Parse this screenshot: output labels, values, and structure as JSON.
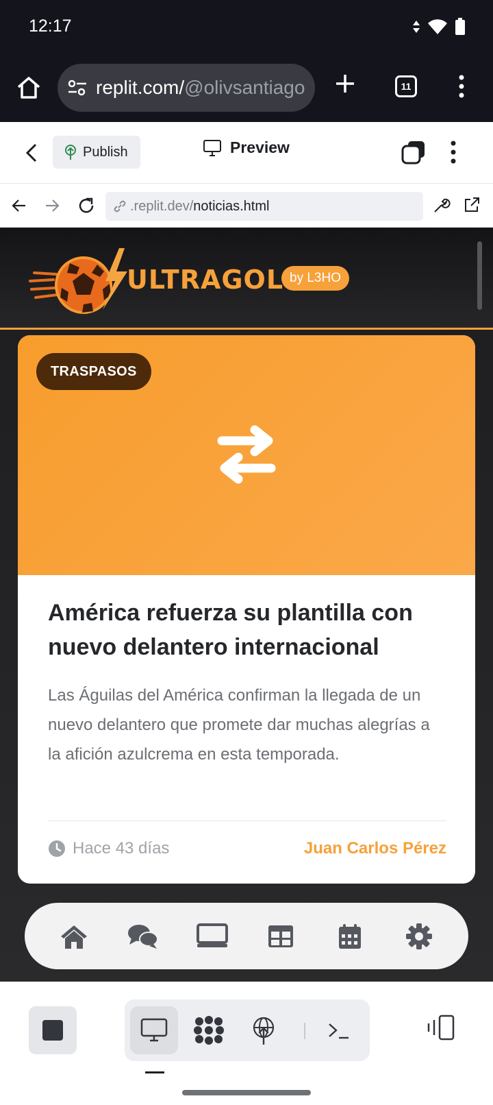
{
  "status_bar": {
    "time": "12:17"
  },
  "chrome": {
    "url_host": "replit.com/",
    "url_path": "@olivsantiago",
    "tab_count": "11"
  },
  "replit_header": {
    "publish_label": "Publish",
    "preview_label": "Preview"
  },
  "preview_nav": {
    "url_prefix": ".replit.dev/",
    "url_path": "noticias.html"
  },
  "site": {
    "logo_text": "ULTRAGOL",
    "badge": "by L3HO",
    "article": {
      "tag": "TRASPASOS",
      "headline": "América refuerza su plantilla con nuevo delantero internacional",
      "summary": "Las Águilas del América confirman la llegada de un nuevo delantero que promete dar muchas alegrías a la afición azulcrema en esta temporada.",
      "time": "Hace 43 días",
      "author": "Juan Carlos Pérez"
    },
    "bottom_nav": [
      "home-icon",
      "comments-icon",
      "desktop-icon",
      "table-icon",
      "calendar-icon",
      "settings-icon"
    ]
  },
  "colors": {
    "accent": "#f6a13a",
    "tag_bg": "#4c2a0a",
    "dark_bg": "#1d1d1f"
  }
}
